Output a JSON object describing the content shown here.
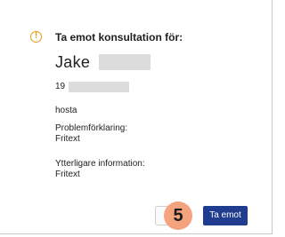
{
  "dialog": {
    "icon": "warning-circle-icon",
    "title": "Ta emot konsultation för:",
    "patient_name": "Jake",
    "personal_number_prefix": "19",
    "reason": "hosta",
    "problem_label": "Problemförklaring:",
    "problem_value": "Fritext",
    "info_label": "Ytterligare information:",
    "info_value": "Fritext",
    "step_badge": "5",
    "accept_label": "Ta emot"
  },
  "colors": {
    "warning": "#e59a18",
    "primary_button": "#1f3c8f",
    "badge": "#f3a47f",
    "redaction": "#dcdcdc"
  }
}
